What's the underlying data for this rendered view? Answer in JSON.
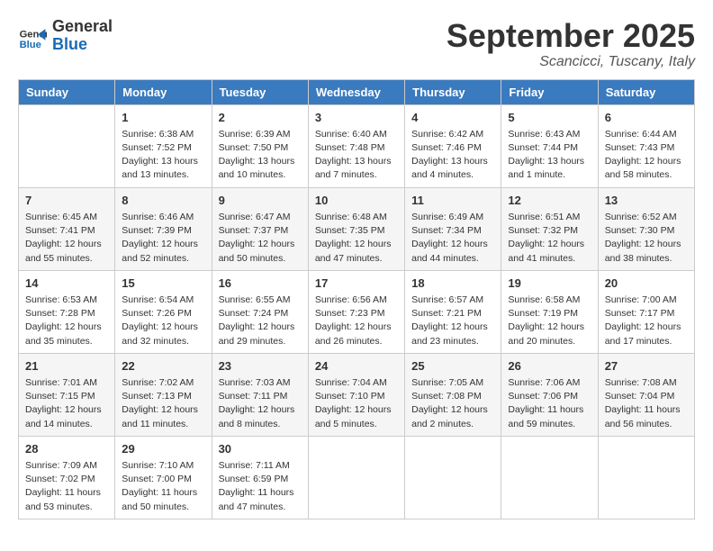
{
  "header": {
    "logo_line1": "General",
    "logo_line2": "Blue",
    "month": "September 2025",
    "location": "Scancicci, Tuscany, Italy"
  },
  "days_of_week": [
    "Sunday",
    "Monday",
    "Tuesday",
    "Wednesday",
    "Thursday",
    "Friday",
    "Saturday"
  ],
  "weeks": [
    [
      {
        "day": "",
        "content": ""
      },
      {
        "day": "1",
        "content": "Sunrise: 6:38 AM\nSunset: 7:52 PM\nDaylight: 13 hours\nand 13 minutes."
      },
      {
        "day": "2",
        "content": "Sunrise: 6:39 AM\nSunset: 7:50 PM\nDaylight: 13 hours\nand 10 minutes."
      },
      {
        "day": "3",
        "content": "Sunrise: 6:40 AM\nSunset: 7:48 PM\nDaylight: 13 hours\nand 7 minutes."
      },
      {
        "day": "4",
        "content": "Sunrise: 6:42 AM\nSunset: 7:46 PM\nDaylight: 13 hours\nand 4 minutes."
      },
      {
        "day": "5",
        "content": "Sunrise: 6:43 AM\nSunset: 7:44 PM\nDaylight: 13 hours\nand 1 minute."
      },
      {
        "day": "6",
        "content": "Sunrise: 6:44 AM\nSunset: 7:43 PM\nDaylight: 12 hours\nand 58 minutes."
      }
    ],
    [
      {
        "day": "7",
        "content": "Sunrise: 6:45 AM\nSunset: 7:41 PM\nDaylight: 12 hours\nand 55 minutes."
      },
      {
        "day": "8",
        "content": "Sunrise: 6:46 AM\nSunset: 7:39 PM\nDaylight: 12 hours\nand 52 minutes."
      },
      {
        "day": "9",
        "content": "Sunrise: 6:47 AM\nSunset: 7:37 PM\nDaylight: 12 hours\nand 50 minutes."
      },
      {
        "day": "10",
        "content": "Sunrise: 6:48 AM\nSunset: 7:35 PM\nDaylight: 12 hours\nand 47 minutes."
      },
      {
        "day": "11",
        "content": "Sunrise: 6:49 AM\nSunset: 7:34 PM\nDaylight: 12 hours\nand 44 minutes."
      },
      {
        "day": "12",
        "content": "Sunrise: 6:51 AM\nSunset: 7:32 PM\nDaylight: 12 hours\nand 41 minutes."
      },
      {
        "day": "13",
        "content": "Sunrise: 6:52 AM\nSunset: 7:30 PM\nDaylight: 12 hours\nand 38 minutes."
      }
    ],
    [
      {
        "day": "14",
        "content": "Sunrise: 6:53 AM\nSunset: 7:28 PM\nDaylight: 12 hours\nand 35 minutes."
      },
      {
        "day": "15",
        "content": "Sunrise: 6:54 AM\nSunset: 7:26 PM\nDaylight: 12 hours\nand 32 minutes."
      },
      {
        "day": "16",
        "content": "Sunrise: 6:55 AM\nSunset: 7:24 PM\nDaylight: 12 hours\nand 29 minutes."
      },
      {
        "day": "17",
        "content": "Sunrise: 6:56 AM\nSunset: 7:23 PM\nDaylight: 12 hours\nand 26 minutes."
      },
      {
        "day": "18",
        "content": "Sunrise: 6:57 AM\nSunset: 7:21 PM\nDaylight: 12 hours\nand 23 minutes."
      },
      {
        "day": "19",
        "content": "Sunrise: 6:58 AM\nSunset: 7:19 PM\nDaylight: 12 hours\nand 20 minutes."
      },
      {
        "day": "20",
        "content": "Sunrise: 7:00 AM\nSunset: 7:17 PM\nDaylight: 12 hours\nand 17 minutes."
      }
    ],
    [
      {
        "day": "21",
        "content": "Sunrise: 7:01 AM\nSunset: 7:15 PM\nDaylight: 12 hours\nand 14 minutes."
      },
      {
        "day": "22",
        "content": "Sunrise: 7:02 AM\nSunset: 7:13 PM\nDaylight: 12 hours\nand 11 minutes."
      },
      {
        "day": "23",
        "content": "Sunrise: 7:03 AM\nSunset: 7:11 PM\nDaylight: 12 hours\nand 8 minutes."
      },
      {
        "day": "24",
        "content": "Sunrise: 7:04 AM\nSunset: 7:10 PM\nDaylight: 12 hours\nand 5 minutes."
      },
      {
        "day": "25",
        "content": "Sunrise: 7:05 AM\nSunset: 7:08 PM\nDaylight: 12 hours\nand 2 minutes."
      },
      {
        "day": "26",
        "content": "Sunrise: 7:06 AM\nSunset: 7:06 PM\nDaylight: 11 hours\nand 59 minutes."
      },
      {
        "day": "27",
        "content": "Sunrise: 7:08 AM\nSunset: 7:04 PM\nDaylight: 11 hours\nand 56 minutes."
      }
    ],
    [
      {
        "day": "28",
        "content": "Sunrise: 7:09 AM\nSunset: 7:02 PM\nDaylight: 11 hours\nand 53 minutes."
      },
      {
        "day": "29",
        "content": "Sunrise: 7:10 AM\nSunset: 7:00 PM\nDaylight: 11 hours\nand 50 minutes."
      },
      {
        "day": "30",
        "content": "Sunrise: 7:11 AM\nSunset: 6:59 PM\nDaylight: 11 hours\nand 47 minutes."
      },
      {
        "day": "",
        "content": ""
      },
      {
        "day": "",
        "content": ""
      },
      {
        "day": "",
        "content": ""
      },
      {
        "day": "",
        "content": ""
      }
    ]
  ]
}
